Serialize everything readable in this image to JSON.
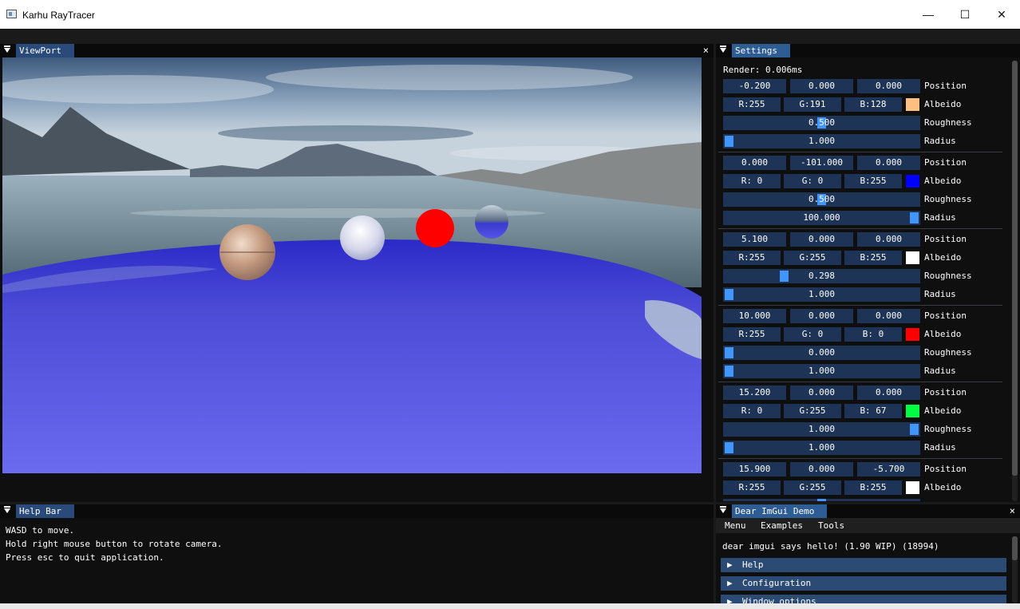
{
  "window": {
    "title": "Karhu RayTracer",
    "min": "—",
    "max": "☐",
    "close": "✕"
  },
  "viewport": {
    "tab": "ViewPort",
    "close": "×"
  },
  "settings": {
    "tab": "Settings",
    "render": "Render: 0.006ms",
    "labels": {
      "position": "Position",
      "albedo": "Albeido",
      "roughness": "Roughness",
      "radius": "Radius"
    },
    "spheres": [
      {
        "pos": [
          "-0.200",
          "0.000",
          "0.000"
        ],
        "rgb": [
          "R:255",
          "G:191",
          "B:128"
        ],
        "color": "#ffbf80",
        "roughness": "0.500",
        "roughness_value": 0.5,
        "radius": "1.000",
        "radius_value": 0.0
      },
      {
        "pos": [
          "0.000",
          "-101.000",
          "0.000"
        ],
        "rgb": [
          "R:  0",
          "G:  0",
          "B:255"
        ],
        "color": "#0000ff",
        "roughness": "0.500",
        "roughness_value": 0.5,
        "radius": "100.000",
        "radius_value": 1.0
      },
      {
        "pos": [
          "5.100",
          "0.000",
          "0.000"
        ],
        "rgb": [
          "R:255",
          "G:255",
          "B:255"
        ],
        "color": "#ffffff",
        "roughness": "0.298",
        "roughness_value": 0.298,
        "radius": "1.000",
        "radius_value": 0.0
      },
      {
        "pos": [
          "10.000",
          "0.000",
          "0.000"
        ],
        "rgb": [
          "R:255",
          "G:  0",
          "B:  0"
        ],
        "color": "#ff0000",
        "roughness": "0.000",
        "roughness_value": 0.0,
        "radius": "1.000",
        "radius_value": 0.0
      },
      {
        "pos": [
          "15.200",
          "0.000",
          "0.000"
        ],
        "rgb": [
          "R:  0",
          "G:255",
          "B: 67"
        ],
        "color": "#00ff43",
        "roughness": "1.000",
        "roughness_value": 1.0,
        "radius": "1.000",
        "radius_value": 0.0
      },
      {
        "pos": [
          "15.900",
          "0.000",
          "-5.700"
        ],
        "rgb": [
          "R:255",
          "G:255",
          "B:255"
        ],
        "color": "#ffffff"
      }
    ]
  },
  "help": {
    "tab": "Help Bar",
    "lines": [
      "WASD to move.",
      "Hold right mouse button to rotate camera.",
      "Press esc to quit application."
    ]
  },
  "demo": {
    "tab": "Dear ImGui Demo",
    "close": "×",
    "menu": [
      "Menu",
      "Examples",
      "Tools"
    ],
    "hello": "dear imgui says hello! (1.90 WIP) (18994)",
    "headers": [
      "Help",
      "Configuration",
      "Window options"
    ]
  }
}
